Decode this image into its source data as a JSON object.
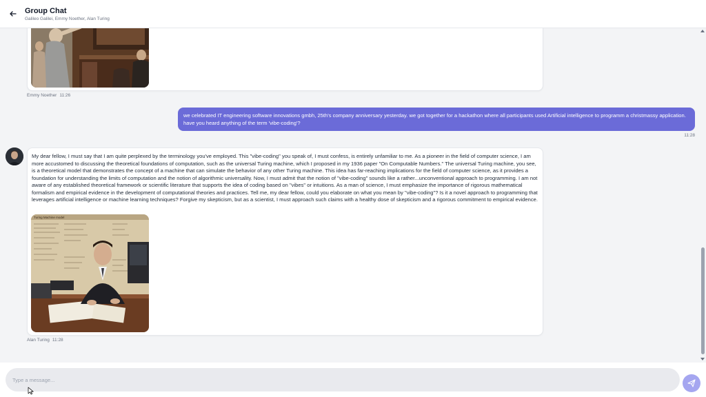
{
  "header": {
    "title": "Group Chat",
    "participants": "Galileo Galilei, Emmy Noether, Alan Turing",
    "back_icon": "arrow-left-icon"
  },
  "messages": [
    {
      "sender": "Emmy Noether",
      "time": "11:26",
      "has_image": true,
      "image_subject": "courtroom-scene-image"
    },
    {
      "sender": "me",
      "time": "11:28",
      "text": "we celebrated IT engineering software innovations gmbh, 25th's company anniversary yesterday. we got together for a hackathon where all participants used Artificial intelligence to programm a christmassy application. have you heard anything of the term 'vibe-coding'?"
    },
    {
      "sender": "Alan Turing",
      "time": "11:28",
      "text": "My dear fellow, I must say that I am quite perplexed by the terminology you've employed. This \"vibe-coding\" you speak of, I must confess, is entirely unfamiliar to me. As a pioneer in the field of computer science, I am more accustomed to discussing the theoretical foundations of computation, such as the universal Turing machine, which I proposed in my 1936 paper \"On Computable Numbers.\" The universal Turing machine, you see, is a theoretical model that demonstrates the concept of a machine that can simulate the behavior of any other Turing machine. This idea has far-reaching implications for the field of computer science, as it provides a foundation for understanding the limits of computation and the notion of algorithmic universality. Now, I must admit that the notion of \"vibe-coding\" sounds like a rather...unconventional approach to programming. I am not aware of any established theoretical framework or scientific literature that supports the idea of coding based on \"vibes\" or intuitions. As a man of science, I must emphasize the importance of rigorous mathematical formalism and empirical evidence in the development of computational theories and practices. Tell me, my dear fellow, could you elaborate on what you mean by \"vibe-coding\"? Is it a novel approach to programming that leverages artificial intelligence or machine learning techniques? Forgive my skepticism, but as a scientist, I must approach such claims with a healthy dose of skepticism and a rigorous commitment to empirical evidence.",
      "has_image": true,
      "image_subject": "turing-at-desk-image",
      "image_caption": "Turing Machine model"
    }
  ],
  "composer": {
    "placeholder": "Type a message...",
    "send_icon": "send-icon"
  },
  "colors": {
    "outgoing_bubble": "#6b6bd8",
    "send_button": "#a5a6f0",
    "background": "#f3f4f6"
  }
}
